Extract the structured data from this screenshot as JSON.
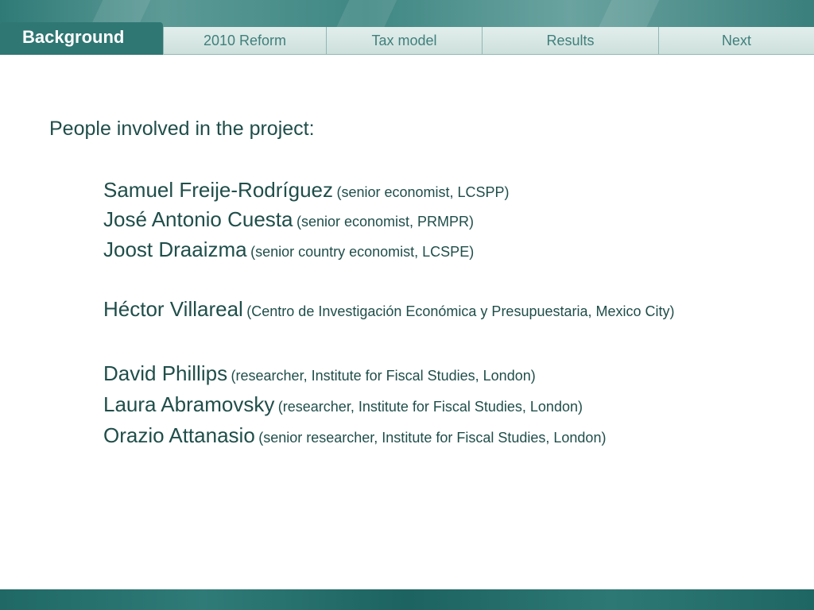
{
  "header": {
    "active_tab": "Background",
    "tabs": [
      {
        "label": "2010 Reform"
      },
      {
        "label": "Tax model"
      },
      {
        "label": "Results"
      },
      {
        "label": "Next"
      }
    ]
  },
  "main": {
    "intro": "People involved in the project:",
    "people": [
      {
        "name": "Samuel Freije-Rodríguez",
        "role": "(senior economist, LCSPP)"
      },
      {
        "name": "José Antonio Cuesta",
        "role": "(senior economist, PRMPR)"
      },
      {
        "name": "Joost Draaizma",
        "role": "(senior country economist, LCSPE)"
      },
      {
        "name": "Héctor Villareal",
        "role": "(Centro de Investigación Económica y Presupuestaria, Mexico City)"
      },
      {
        "name": "David Phillips",
        "role": "(researcher, Institute for Fiscal Studies, London)"
      },
      {
        "name": "Laura Abramovsky",
        "role": "(researcher, Institute for Fiscal Studies, London)"
      },
      {
        "name": "Orazio Attanasio",
        "role": "(senior researcher, Institute for Fiscal Studies, London)"
      }
    ]
  },
  "colors": {
    "accent": "#2f7773",
    "text": "#1f4e4a",
    "tab_bg": "#d4e4e1"
  }
}
